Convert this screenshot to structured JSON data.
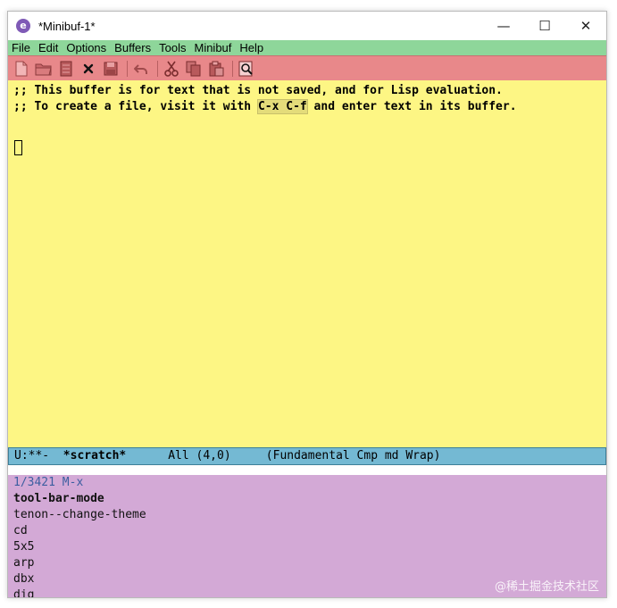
{
  "window": {
    "title": "*Minibuf-1*",
    "app_icon_letter": "e",
    "controls": {
      "minimize": "—",
      "maximize": "☐",
      "close": "✕"
    }
  },
  "menubar": {
    "items": [
      "File",
      "Edit",
      "Options",
      "Buffers",
      "Tools",
      "Minibuf",
      "Help"
    ]
  },
  "toolbar": {
    "icons": [
      "new-file-icon",
      "open-folder-icon",
      "dired-icon",
      "close-icon",
      "save-icon",
      "undo-icon",
      "cut-icon",
      "copy-icon",
      "paste-icon",
      "search-icon"
    ]
  },
  "editor": {
    "line1": ";; This buffer is for text that is not saved, and for Lisp evaluation.",
    "line2_prefix": ";; To create a file, visit it with ",
    "line2_key": "C-x C-f",
    "line2_suffix": " and enter text in its buffer."
  },
  "modeline": {
    "status": "U:**-  ",
    "buffer_name": "*scratch*",
    "position": "      All (4,0)     ",
    "modes": "(Fundamental Cmp md Wrap)"
  },
  "minibuffer": {
    "prompt": "1/3421 M-x",
    "selected": "tool-bar-mode",
    "candidates": [
      "tenon--change-theme",
      "cd",
      "5x5",
      "arp",
      "dbx",
      "dig"
    ]
  },
  "watermark": "@稀土掘金技术社区",
  "colors": {
    "menubar_bg": "#8ed69a",
    "toolbar_bg": "#e8888a",
    "editor_bg": "#fdf684",
    "modeline_bg": "#74b9d3",
    "minibuffer_bg": "#d3a9d6"
  }
}
